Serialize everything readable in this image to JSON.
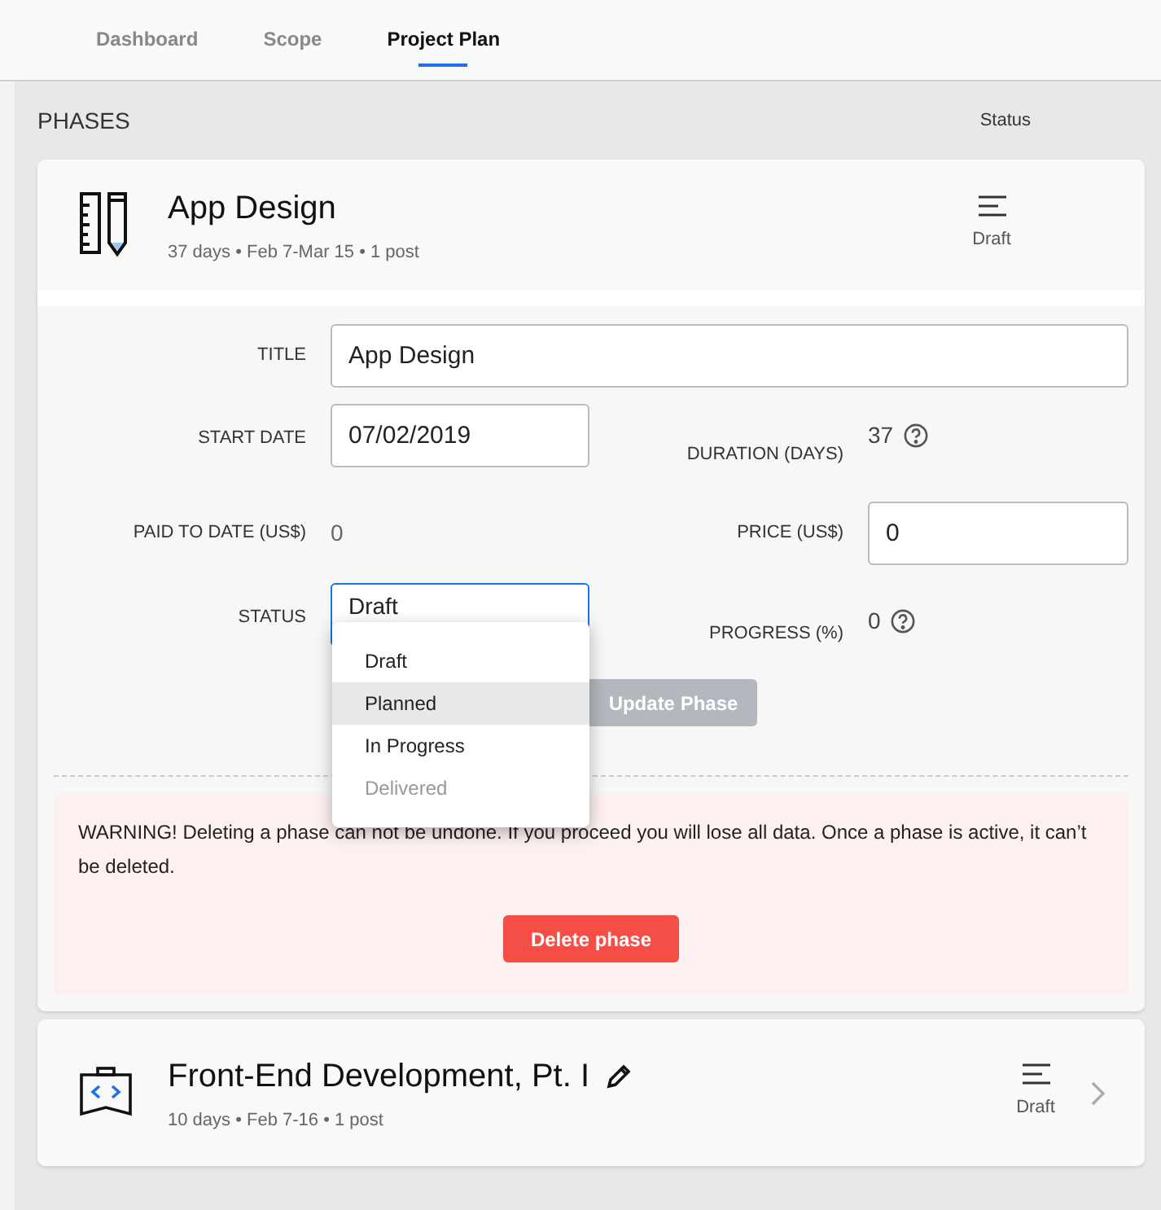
{
  "tabs": [
    {
      "label": "Dashboard",
      "selected": false
    },
    {
      "label": "Scope",
      "selected": false
    },
    {
      "label": "Project Plan",
      "selected": true
    }
  ],
  "phases_header": {
    "title": "PHASES",
    "status_label": "Status"
  },
  "phases": [
    {
      "kind": "expanded",
      "title": "App Design",
      "meta": "37 days • Feb 7-Mar 15 • 1 post",
      "status": "Draft",
      "editable": false,
      "form": {
        "title_label": "TITLE",
        "title_value": "App Design",
        "start_date_label": "START DATE",
        "start_date_value": "07/02/2019",
        "duration_label": "DURATION (DAYS)",
        "duration_value": "37",
        "paid_label": "PAID TO DATE (US$)",
        "paid_value": "0",
        "price_label": "PRICE (US$)",
        "price_value": "0",
        "status_label": "STATUS",
        "status_value": "Draft",
        "progress_label": "PROGRESS (%)",
        "progress_value": "0",
        "status_options": [
          {
            "label": "Draft",
            "highlighted": false,
            "disabled": false
          },
          {
            "label": "Planned",
            "highlighted": true,
            "disabled": false
          },
          {
            "label": "In Progress",
            "highlighted": false,
            "disabled": false
          },
          {
            "label": "Delivered",
            "highlighted": false,
            "disabled": true
          }
        ],
        "update_button": {
          "label": "Update Phase",
          "disabled": true
        }
      },
      "warning": {
        "text": "WARNING! Deleting a phase can not be undone. If you proceed you will lose all data. Once a phase is active, it can’t be deleted.",
        "button": "Delete phase"
      }
    },
    {
      "kind": "collapsed",
      "title": "Front-End Development, Pt. I",
      "meta": "10 days • Feb 7-16 • 1 post",
      "status": "Draft",
      "editable": true
    }
  ]
}
